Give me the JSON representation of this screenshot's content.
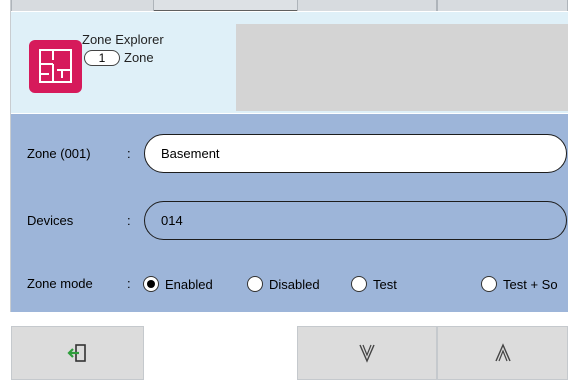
{
  "header": {
    "app_title": "Zone Explorer",
    "count": "1",
    "count_label": "Zone",
    "icon": "floorplan-icon",
    "icon_color": "#d61a5b"
  },
  "form": {
    "zone_label": "Zone (001)",
    "zone_value": "Basement",
    "devices_label": "Devices",
    "devices_value": "014",
    "mode_label": "Zone mode",
    "colon": ":",
    "mode_options": [
      {
        "label": "Enabled",
        "checked": true
      },
      {
        "label": "Disabled",
        "checked": false
      },
      {
        "label": "Test",
        "checked": false
      },
      {
        "label": "Test + So",
        "checked": false
      }
    ]
  },
  "bottom_bar": {
    "exit_icon": "exit-icon",
    "down_icon": "chevron-down-icon",
    "up_icon": "chevron-up-icon"
  },
  "colors": {
    "header_bg": "#dff0f8",
    "form_bg": "#9db5d9",
    "accent": "#d61a5b",
    "exit_icon_color": "#2e9e3c"
  }
}
